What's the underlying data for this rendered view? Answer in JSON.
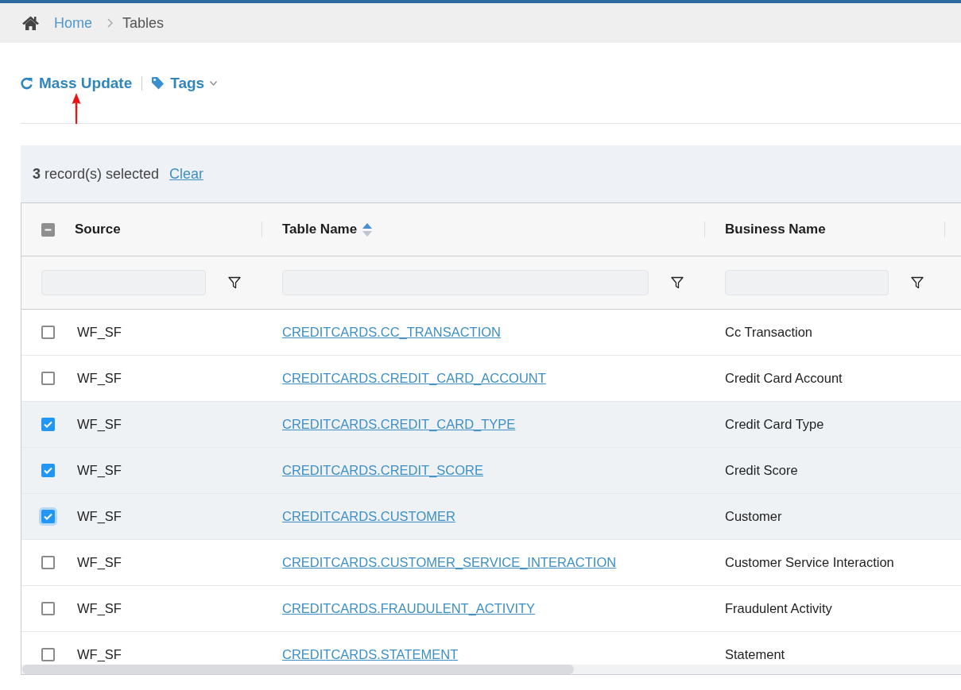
{
  "breadcrumb": [
    {
      "label": "Home",
      "kind": "link"
    },
    {
      "label": "Tables",
      "kind": "current"
    }
  ],
  "toolbar": {
    "actions": [
      {
        "label": "Mass Update",
        "kind": "refresh"
      },
      {
        "label": "Tags",
        "kind": "tags"
      }
    ]
  },
  "selection_bar": {
    "text": "**3** record(s) selected",
    "action": "Clear"
  },
  "table": {
    "header_checkbox": {
      "indeterminate": true
    },
    "columns": [
      {
        "label": "Source",
        "sorted": false
      },
      {
        "label": "Table Name",
        "sorted": true
      },
      {
        "label": "Business Name",
        "sorted": false
      }
    ],
    "rows": [
      {
        "selected": false,
        "focused": false,
        "source": "WF_SF",
        "table_name": "CREDITCARDS.CC_TRANSACTION",
        "business_name": "Cc Transaction"
      },
      {
        "selected": false,
        "focused": false,
        "source": "WF_SF",
        "table_name": "CREDITCARDS.CREDIT_CARD_ACCOUNT",
        "business_name": "Credit Card Account"
      },
      {
        "selected": true,
        "focused": false,
        "source": "WF_SF",
        "table_name": "CREDITCARDS.CREDIT_CARD_TYPE",
        "business_name": "Credit Card Type"
      },
      {
        "selected": true,
        "focused": false,
        "source": "WF_SF",
        "table_name": "CREDITCARDS.CREDIT_SCORE",
        "business_name": "Credit Score"
      },
      {
        "selected": true,
        "focused": true,
        "source": "WF_SF",
        "table_name": "CREDITCARDS.CUSTOMER",
        "business_name": "Customer"
      },
      {
        "selected": false,
        "focused": false,
        "source": "WF_SF",
        "table_name": "CREDITCARDS.CUSTOMER_SERVICE_INTERACTION",
        "business_name": "Customer Service Interaction"
      },
      {
        "selected": false,
        "focused": false,
        "source": "WF_SF",
        "table_name": "CREDITCARDS.FRAUDULENT_ACTIVITY",
        "business_name": "Fraudulent Activity"
      },
      {
        "selected": false,
        "focused": false,
        "source": "WF_SF",
        "table_name": "CREDITCARDS.STATEMENT",
        "business_name": "Statement"
      }
    ]
  }
}
